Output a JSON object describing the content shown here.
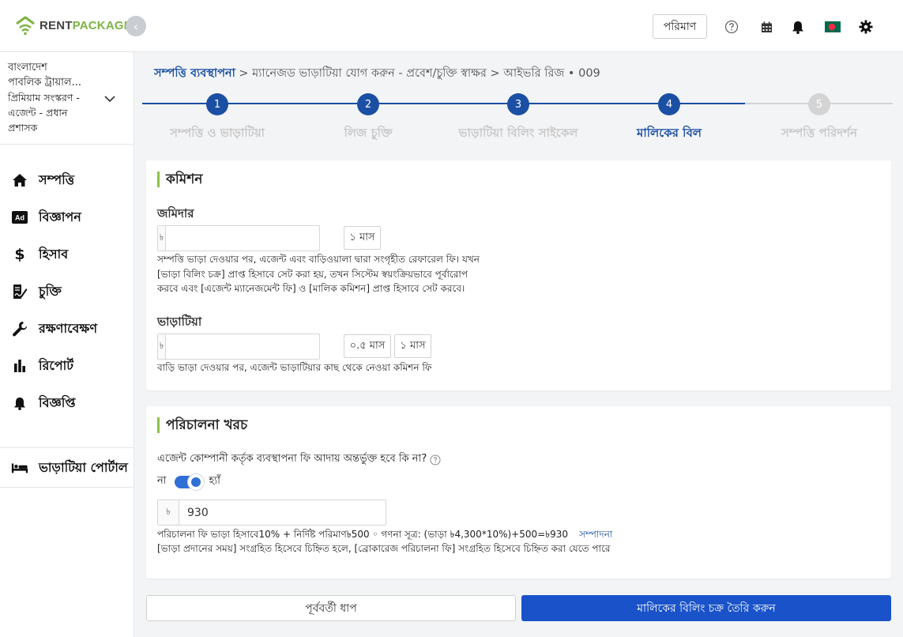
{
  "header": {
    "logo_part1": "RENT",
    "logo_part2": "PACKAGE",
    "collapse_glyph": "‹",
    "quantity_label": "পরিমাণ",
    "icons": [
      "help-circle-icon",
      "calendar-icon",
      "bell-icon",
      "flag-icon",
      "gear-icon"
    ]
  },
  "sidebar": {
    "org_line1": "বাংলাদেশ",
    "org_line2": "পাবলিক ট্রায়াল...",
    "org_line3": "প্রিমিয়াম সংস্করণ -",
    "org_line4": "এজেন্ট - প্রধান",
    "org_line5": "প্রশাসক",
    "items": [
      {
        "label": "সম্পত্তি",
        "icon": "home-icon"
      },
      {
        "label": "বিজ্ঞাপন",
        "icon": "ad-icon"
      },
      {
        "label": "হিসাব",
        "icon": "dollar-icon"
      },
      {
        "label": "চুক্তি",
        "icon": "contract-icon"
      },
      {
        "label": "রক্ষণাবেক্ষণ",
        "icon": "wrench-icon"
      },
      {
        "label": "রিপোর্ট",
        "icon": "bar-chart-icon"
      },
      {
        "label": "বিজ্ঞপ্তি",
        "icon": "bell-icon"
      }
    ],
    "tenant_portal": "ভাড়াটিয়া পোর্টাল"
  },
  "breadcrumb": {
    "root": "সম্পত্তি ব্যবস্থাপনা",
    "rest": " > ম্যানেজড ভাড়াটিয়া যোগ করুন - প্রবেশ/চুক্তি স্বাক্ষর > আইভরি রিজ • 009"
  },
  "stepper": {
    "steps": [
      {
        "num": "1",
        "label": "সম্পত্তি ও ভাড়াটিয়া"
      },
      {
        "num": "2",
        "label": "লিজ চুক্তি"
      },
      {
        "num": "3",
        "label": "ভাড়াটিয়া বিলিং সাইকেল"
      },
      {
        "num": "4",
        "label": "মালিকের বিল"
      },
      {
        "num": "5",
        "label": "সম্পত্তি পরিদর্শন"
      }
    ],
    "active_step": 4,
    "colors": {
      "active": "#1a4fa3",
      "inactive": "#d4d4d4"
    }
  },
  "commission": {
    "title": "কমিশন",
    "landlord": {
      "label": "জমিদার",
      "currency": "৳",
      "value": "",
      "chips": [
        "১ মাস"
      ],
      "help_line1": "সম্পত্তি ভাড়া দেওয়ার পর, এজেন্ট এবং বাড়িওয়ালা দ্বারা সংগৃহীত রেফারেল ফি। যখন",
      "help_line2": "[ভাড়া বিলিং চক্র] প্রাপ্ত হিসাবে সেট করা হয়, তখন সিস্টেম স্বয়ংক্রিয়ভাবে পূর্বারোপ",
      "help_line3": "করবে এবং [এজেন্ট ম্যানেজমেন্ট ফি] ও [মালিক কমিশন] প্রাপ্ত হিসাবে সেট করবে।"
    },
    "tenant": {
      "label": "ভাড়াটিয়া",
      "currency": "৳",
      "value": "",
      "chips": [
        "০.৫ মাস",
        "১ মাস"
      ],
      "help": "বাড়ি ভাড়া দেওয়ার পর, এজেন্ট ভাড়াটিয়ার কাছ থেকে নেওয়া কমিশন ফি"
    }
  },
  "operating": {
    "title": "পরিচালনা খরচ",
    "question": "এজেন্ট কোম্পানী কর্তৃক ব্যবস্থাপনা ফি আদায় অন্তর্ভুক্ত হবে কি না?",
    "no": "না",
    "yes": "হ্যাঁ",
    "toggle_on": true,
    "currency": "৳",
    "value": "930",
    "formula": "পরিচালনা ফি ভাড়া হিসাবে10% + নির্দিষ্ট পরিমাণ৳500 ◦ গণনা সূত্র: (ভাড়া ৳4,300*10%)+500=৳930",
    "edit": "সম্পাদনা",
    "note": "[ভাড়া প্রদানের সময়] সংগ্রহিত হিসেবে চিহ্নিত হলে, [ব্রোকারেজ পরিচালনা ফি] সংগ্রহিত হিসেবে চিহ্নিত করা যেতে পারে"
  },
  "footer": {
    "prev": "পূর্ববর্তী ধাপ",
    "next": "মালিকের বিলিং চক্র তৈরি করুন"
  }
}
